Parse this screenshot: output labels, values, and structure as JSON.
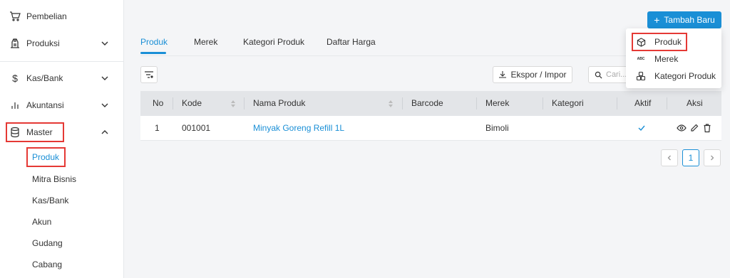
{
  "sidebar": {
    "items": [
      {
        "label": "Pembelian",
        "icon": "cart-icon"
      },
      {
        "label": "Produksi",
        "icon": "factory-icon"
      },
      {
        "label": "Kas/Bank",
        "icon": "dollar-icon"
      },
      {
        "label": "Akuntansi",
        "icon": "bar-chart-icon"
      },
      {
        "label": "Master",
        "icon": "database-icon"
      }
    ],
    "submenu": [
      "Produk",
      "Mitra Bisnis",
      "Kas/Bank",
      "Akun",
      "Gudang",
      "Cabang"
    ]
  },
  "header": {
    "add_button": "Tambah Baru"
  },
  "tabs": [
    "Produk",
    "Merek",
    "Kategori Produk",
    "Daftar Harga"
  ],
  "toolbar": {
    "export_label": "Ekspor / Impor",
    "search_placeholder": "Cari..."
  },
  "table": {
    "columns": [
      "No",
      "Kode",
      "Nama Produk",
      "Barcode",
      "Merek",
      "Kategori",
      "Aktif",
      "Aksi"
    ],
    "rows": [
      {
        "no": "1",
        "kode": "001001",
        "nama": "Minyak Goreng Refill 1L",
        "barcode": "",
        "merek": "Bimoli",
        "kategori": "",
        "aktif": true
      }
    ]
  },
  "pagination": {
    "current_page": "1"
  },
  "dropdown": {
    "items": [
      {
        "label": "Produk",
        "icon": "cube-icon"
      },
      {
        "label": "Merek",
        "icon": "brand-icon"
      },
      {
        "label": "Kategori Produk",
        "icon": "boxes-icon"
      }
    ]
  },
  "colors": {
    "accent": "#1a8fd6",
    "highlight": "#e53935"
  }
}
